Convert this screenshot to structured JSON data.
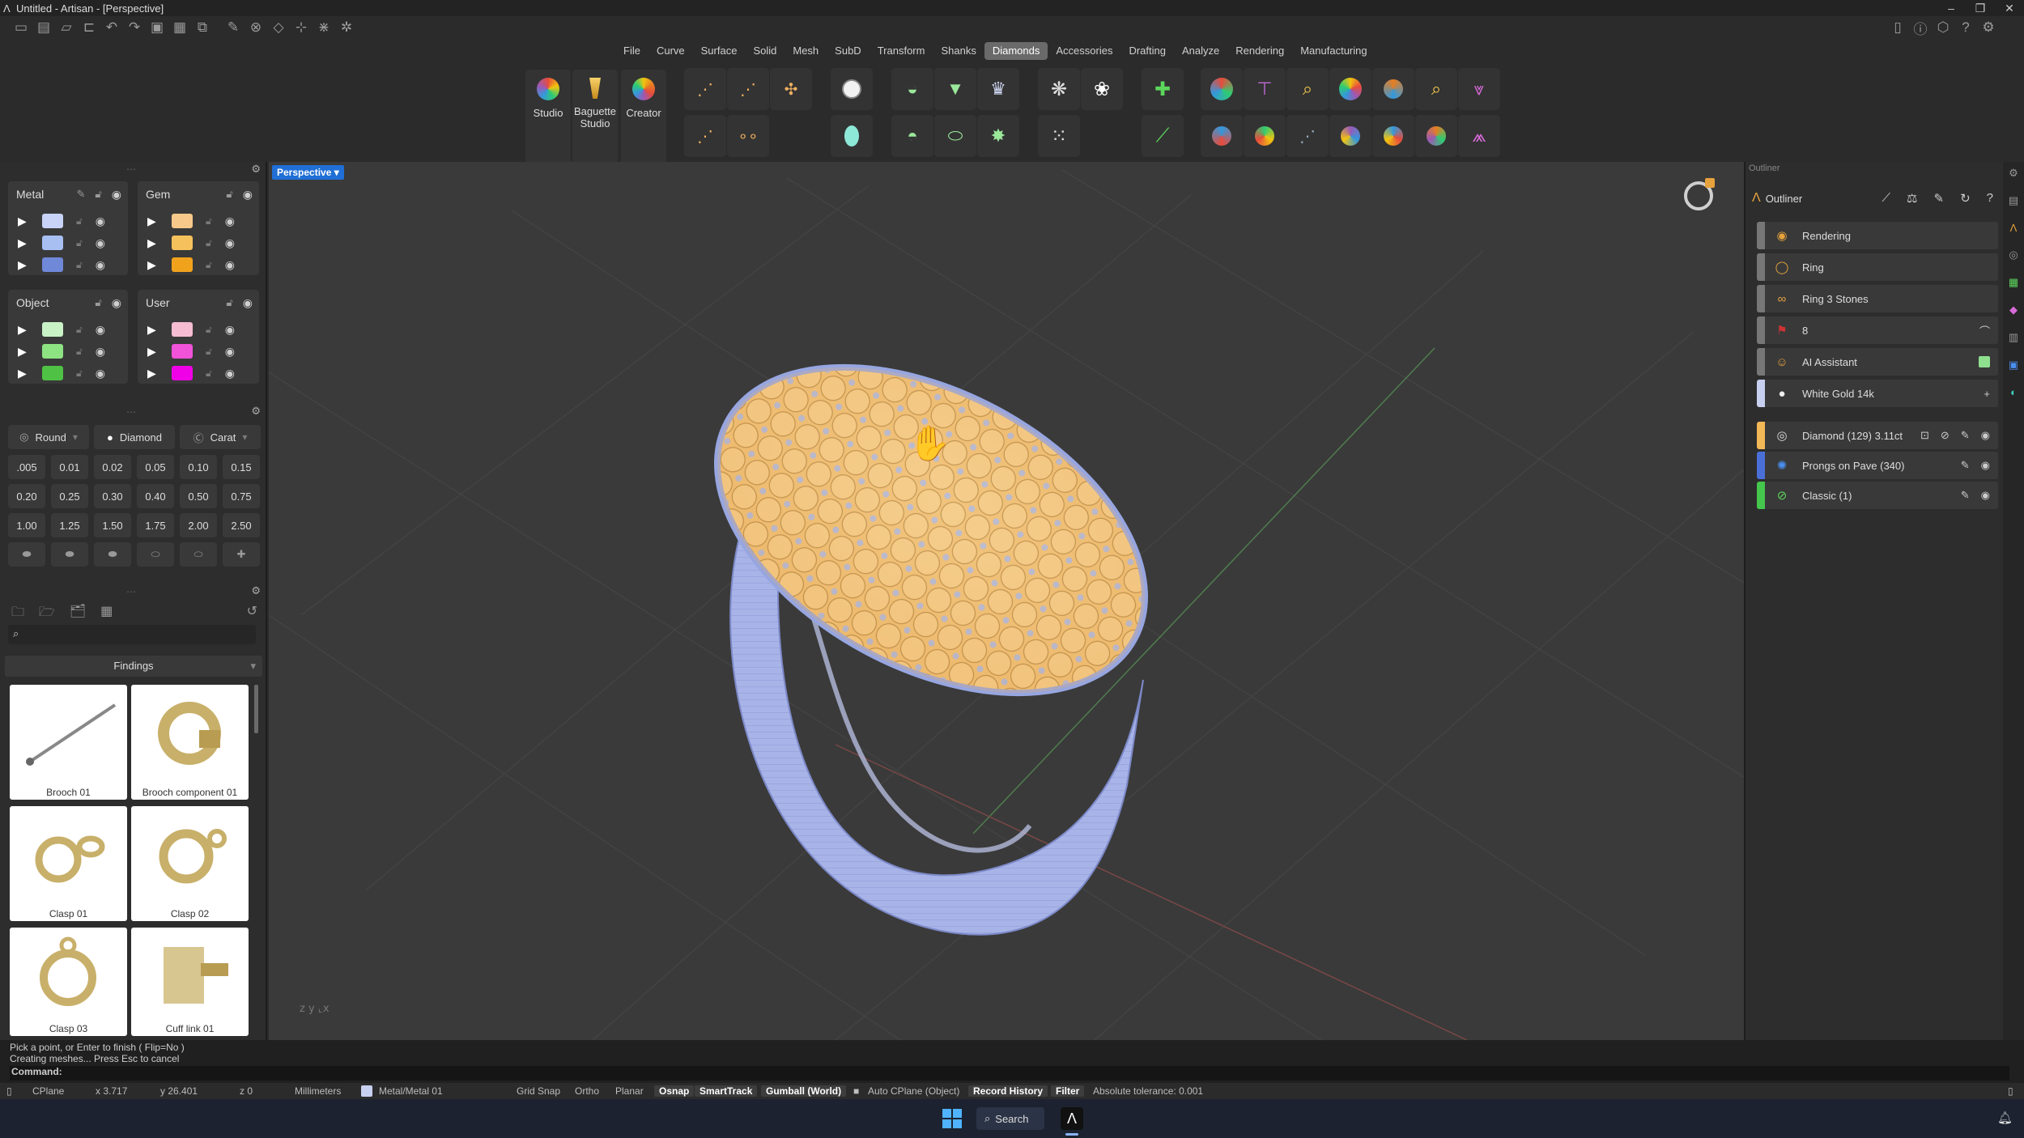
{
  "window": {
    "title": "Untitled - Artisan - [Perspective]"
  },
  "menu": [
    "File",
    "Curve",
    "Surface",
    "Solid",
    "Mesh",
    "SubD",
    "Transform",
    "Shanks",
    "Diamonds",
    "Accessories",
    "Drafting",
    "Analyze",
    "Rendering",
    "Manufacturing"
  ],
  "active_menu": "Diamonds",
  "ribbon": {
    "studio_label": "Studio",
    "baguette_label": "Baguette Studio",
    "creator_label": "Creator"
  },
  "layers": {
    "metal": {
      "label": "Metal",
      "colors": [
        "#c8d3f7",
        "#a8bff2",
        "#6f88d8"
      ]
    },
    "gem": {
      "label": "Gem",
      "colors": [
        "#f6c98a",
        "#f4c15c",
        "#f0a21d"
      ]
    },
    "object": {
      "label": "Object",
      "colors": [
        "#c9f2c6",
        "#8de382",
        "#4fc145"
      ]
    },
    "user": {
      "label": "User",
      "colors": [
        "#f6bcd2",
        "#f052d8",
        "#f000e6"
      ]
    }
  },
  "gem_shapes": {
    "round": "Round",
    "diamond": "Diamond",
    "carat": "Carat"
  },
  "sizes": [
    ".005",
    "0.01",
    "0.02",
    "0.05",
    "0.10",
    "0.15",
    "0.20",
    "0.25",
    "0.30",
    "0.40",
    "0.50",
    "0.75",
    "1.00",
    "1.25",
    "1.50",
    "1.75",
    "2.00",
    "2.50"
  ],
  "library": {
    "category": "Findings",
    "items": [
      "Brooch 01",
      "Brooch component 01",
      "Clasp 01",
      "Clasp 02",
      "Clasp 03",
      "Cuff link 01"
    ]
  },
  "viewport": {
    "label": "Perspective"
  },
  "outliner": {
    "panel_title": "Outliner",
    "tab_label": "Outliner",
    "items": [
      {
        "label": "Rendering",
        "icon": "palette-icon"
      },
      {
        "label": "Ring",
        "icon": "ring-icon"
      },
      {
        "label": "Ring 3 Stones",
        "icon": "stones-icon"
      },
      {
        "label": "8",
        "icon": "flag-icon"
      },
      {
        "label": "AI Assistant",
        "icon": "robot-icon"
      },
      {
        "label": "White Gold 14k",
        "icon": "sphere-icon"
      }
    ],
    "objects": [
      {
        "label": "Diamond (129) 3.11ct",
        "color": "#f2b857"
      },
      {
        "label": "Prongs on Pave (340)",
        "color": "#4a6fd8"
      },
      {
        "label": "Classic (1)",
        "color": "#45c64d"
      }
    ]
  },
  "command": {
    "prompt_line": "Pick a point, or Enter to finish ( Flip=No )",
    "history_line": "Creating meshes... Press Esc to cancel",
    "label": "Command:"
  },
  "status": {
    "cplane": "CPlane",
    "x": "x 3.717",
    "y": "y 26.401",
    "z": "z 0",
    "units": "Millimeters",
    "layer": "Metal/Metal 01",
    "grid_snap": "Grid Snap",
    "ortho": "Ortho",
    "planar": "Planar",
    "osnap": "Osnap",
    "smarttrack": "SmartTrack",
    "gumball": "Gumball (World)",
    "auto_cplane": "Auto CPlane (Object)",
    "record_history": "Record History",
    "filter": "Filter",
    "tolerance": "Absolute tolerance: 0.001"
  },
  "taskbar": {
    "search": "Search"
  }
}
